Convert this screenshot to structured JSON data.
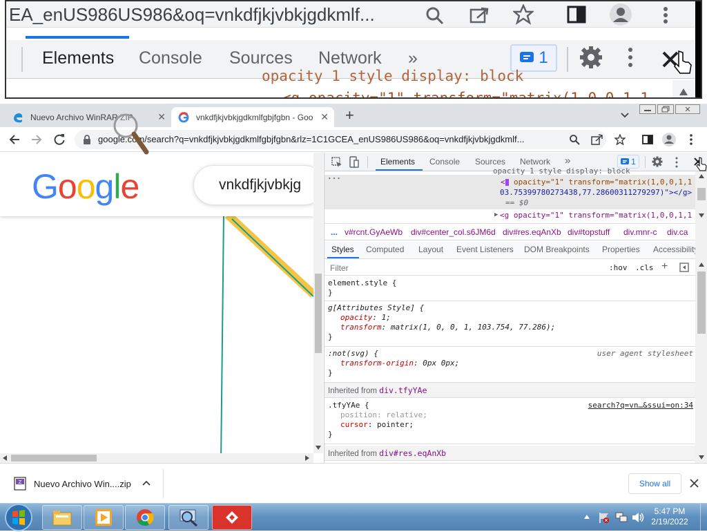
{
  "zoom": {
    "url_text": "EA_enUS986US986&oq=vnkdfjkjvbkjgdkmlf...",
    "tabs": [
      "Elements",
      "Console",
      "Sources",
      "Network",
      "»"
    ],
    "issues_count": "1",
    "code_line1": "opacity  1  style  display: block",
    "code_line2": "<g opacity=\"1\" transform=\"matrix(1,0,0,1,1"
  },
  "browser": {
    "tabs": [
      {
        "title": "Nuevo Archivo WinRAR ZIP"
      },
      {
        "title": "vnkdfjkjvbkjgdkmlfgbjfgbn - Goo"
      }
    ],
    "new_tab": "+",
    "url": "google.com/search?q=vnkdfjkjvbkjgdkmlfgbjfgbn&rlz=1C1GCEA_enUS986US986&oq=vnkdfjkjvbkjgdkmlf..."
  },
  "page": {
    "logo": "Google",
    "search_value": "vnkdfjkjvbkjg"
  },
  "devtools": {
    "tabs": [
      "Elements",
      "Console",
      "Sources",
      "Network",
      "»"
    ],
    "issues_count": "1",
    "dom": {
      "line0": "opacity  1  style  display: block",
      "line1_a": "opacity=\"1\" transform=\"matrix(1,0,0,1,1",
      "line1_b": "03.75399780273438,77.28600311279297)\"></g>",
      "line1_c": "== $0",
      "line2": "<g opacity=\"1\" transform=\"matrix(1,0,0,1,1"
    },
    "breadcrumbs": [
      "...",
      "v#rcnt.GyAeWb",
      "div#center_col.s6JM6d",
      "div#res.eqAnXb",
      "div#topstuff",
      "div.mnr-c",
      "div.ca"
    ],
    "style_tabs": [
      "Styles",
      "Computed",
      "Layout",
      "Event Listeners",
      "DOM Breakpoints",
      "Properties",
      "Accessibility"
    ],
    "filter_placeholder": "Filter",
    "hov": ":hov",
    "cls": ".cls",
    "rules": {
      "r1_sel": "element.style {",
      "r1_close": "}",
      "r2_sel": "g[Attributes Style] {",
      "r2_p1_name": "opacity",
      "r2_p1_val": ": 1;",
      "r2_p2_name": "transform",
      "r2_p2_val": ": matrix(1, 0, 0, 1, 103.754, 77.286);",
      "r2_close": "}",
      "r3_sel": ":not(svg) {",
      "r3_src": "user agent stylesheet",
      "r3_p1_name": "transform-origin",
      "r3_p1_val": ": 0px 0px;",
      "r3_close": "}",
      "inh1_label": "Inherited from ",
      "inh1_node": "div.tfyYAe",
      "r4_sel": ".tfyYAe {",
      "r4_src": "search?q=vn…&ssui=on:34",
      "r4_p1_name": "position",
      "r4_p1_val": ": relative;",
      "r4_p2_name": "cursor",
      "r4_p2_val": ": pointer;",
      "r4_close": "}",
      "inh2_label": "Inherited from ",
      "inh2_node": "div#res.eqAnXb"
    }
  },
  "download": {
    "file": "Nuevo Archivo Win....zip",
    "show_all": "Show all"
  },
  "taskbar": {
    "time": "5:47 PM",
    "date": "2/19/2022"
  },
  "colors": {
    "accent": "#1a73e8",
    "google_blue": "#4285f4",
    "google_red": "#ea4335",
    "google_yellow": "#fbbc05",
    "google_green": "#34a853"
  }
}
